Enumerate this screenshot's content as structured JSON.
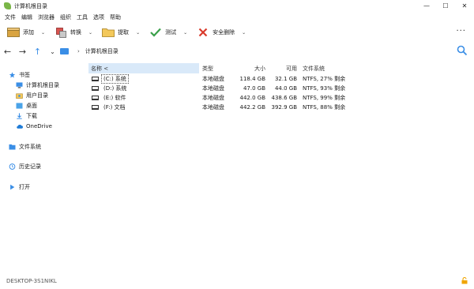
{
  "window": {
    "title": "计算机根目录",
    "minimize": "—",
    "maximize": "☐",
    "close": "✕"
  },
  "menu": [
    "文件",
    "编辑",
    "浏览器",
    "组织",
    "工具",
    "选项",
    "帮助"
  ],
  "toolbar": {
    "add": "添加",
    "convert": "转换",
    "extract": "提取",
    "test": "测试",
    "delete": "安全删除",
    "more": "···",
    "dropdown": "⌄"
  },
  "addressbar": {
    "back": "←",
    "forward": "→",
    "up": "↑",
    "history": "⌄",
    "crumb_sep": "›",
    "path": "计算机根目录"
  },
  "sidebar": {
    "bookmarks": "书签",
    "computer_root": "计算机根目录",
    "user_dir": "用户目录",
    "desktop": "桌面",
    "downloads": "下载",
    "onedrive": "OneDrive",
    "file_system": "文件系统",
    "history": "历史记录",
    "open": "打开"
  },
  "table": {
    "headers": {
      "name": "名称 <",
      "type": "类型",
      "size": "大小",
      "free": "可用",
      "fs": "文件系统"
    },
    "rows": [
      {
        "name": "(C:) 系统",
        "type": "本地磁盘",
        "size": "118.4 GB",
        "free": "32.1 GB",
        "fs": "NTFS, 27% 剩余"
      },
      {
        "name": "(D:) 系统",
        "type": "本地磁盘",
        "size": "47.0 GB",
        "free": "44.0 GB",
        "fs": "NTFS, 93% 剩余"
      },
      {
        "name": "(E:) 软件",
        "type": "本地磁盘",
        "size": "442.0 GB",
        "free": "438.6 GB",
        "fs": "NTFS, 99% 剩余"
      },
      {
        "name": "(F:) 文档",
        "type": "本地磁盘",
        "size": "442.2 GB",
        "free": "392.9 GB",
        "fs": "NTFS, 88% 剩余"
      }
    ]
  },
  "status": {
    "computer": "DESKTOP-3S1NIKL"
  },
  "colors": {
    "accent": "#3a8ee6",
    "sorted_header": "#d9e9f9",
    "lock": "#f0a500"
  }
}
